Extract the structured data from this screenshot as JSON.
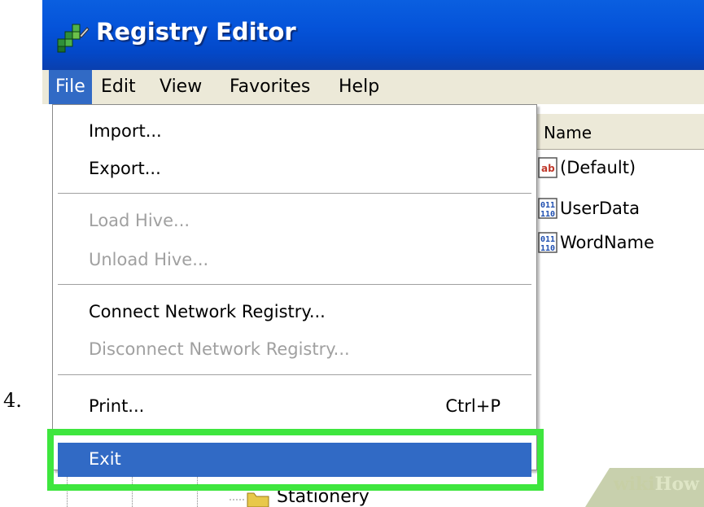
{
  "step_number": "4.",
  "window": {
    "title": "Registry Editor"
  },
  "menubar": {
    "items": [
      {
        "label": "File",
        "active": true
      },
      {
        "label": "Edit"
      },
      {
        "label": "View"
      },
      {
        "label": "Favorites"
      },
      {
        "label": "Help"
      }
    ]
  },
  "file_menu": {
    "import": "Import...",
    "export": "Export...",
    "load_hive": "Load Hive...",
    "unload_hive": "Unload Hive...",
    "connect": "Connect Network Registry...",
    "disconnect": "Disconnect Network Registry...",
    "print": "Print...",
    "print_shortcut": "Ctrl+P",
    "exit": "Exit"
  },
  "values_pane": {
    "header": "Name",
    "rows": [
      {
        "name": "(Default)",
        "icon": "string-value-icon"
      },
      {
        "name": "UserData",
        "icon": "binary-value-icon"
      },
      {
        "name": "WordName",
        "icon": "binary-value-icon"
      }
    ]
  },
  "tree": {
    "partial_item": "Stationery"
  },
  "watermark": {
    "wiki": "wiki",
    "how": "How"
  },
  "colors": {
    "title_bar": "#0553d9",
    "menu_highlight": "#316ac5",
    "callout_green": "#3ee63e"
  }
}
